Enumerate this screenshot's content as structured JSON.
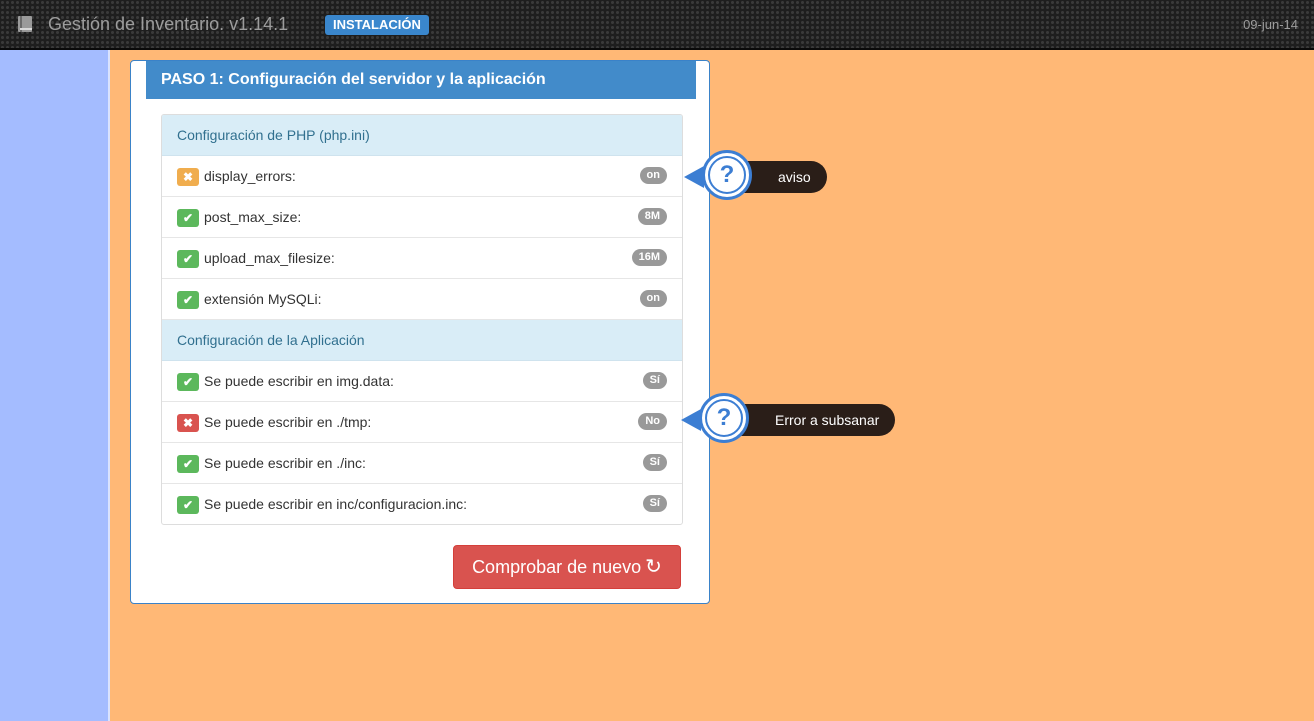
{
  "header": {
    "app_title": "Gestión de Inventario. v1.14.1",
    "mode_badge": "INSTALACIÓN",
    "date": "09-jun-14"
  },
  "panel": {
    "title": "PASO 1: Configuración del servidor y la aplicación",
    "sections": [
      {
        "title": "Configuración de PHP (php.ini)",
        "items": [
          {
            "label": "display_errors:",
            "value": "on",
            "status": "warn"
          },
          {
            "label": "post_max_size:",
            "value": "8M",
            "status": "ok"
          },
          {
            "label": "upload_max_filesize:",
            "value": "16M",
            "status": "ok"
          },
          {
            "label": "extensión MySQLi:",
            "value": "on",
            "status": "ok"
          }
        ]
      },
      {
        "title": "Configuración de la Aplicación",
        "items": [
          {
            "label": "Se puede escribir en img.data:",
            "value": "Sí",
            "status": "ok"
          },
          {
            "label": "Se puede escribir en ./tmp:",
            "value": "No",
            "status": "error"
          },
          {
            "label": "Se puede escribir en ./inc:",
            "value": "Sí",
            "status": "ok"
          },
          {
            "label": "Se puede escribir en inc/configuracion.inc:",
            "value": "Sí",
            "status": "ok"
          }
        ]
      }
    ],
    "recheck_label": "Comprobar de nuevo"
  },
  "tooltips": {
    "warning": "aviso",
    "error": "Error a subsanar"
  },
  "icons": {
    "ok": "check-icon",
    "warn": "x-icon",
    "error": "x-icon",
    "refresh": "refresh-icon"
  },
  "colors": {
    "background": "#ffb876",
    "left_band": "#a4bcff",
    "primary": "#428bca",
    "success": "#5cb85c",
    "warning": "#f0ad4e",
    "danger": "#d9534f"
  }
}
